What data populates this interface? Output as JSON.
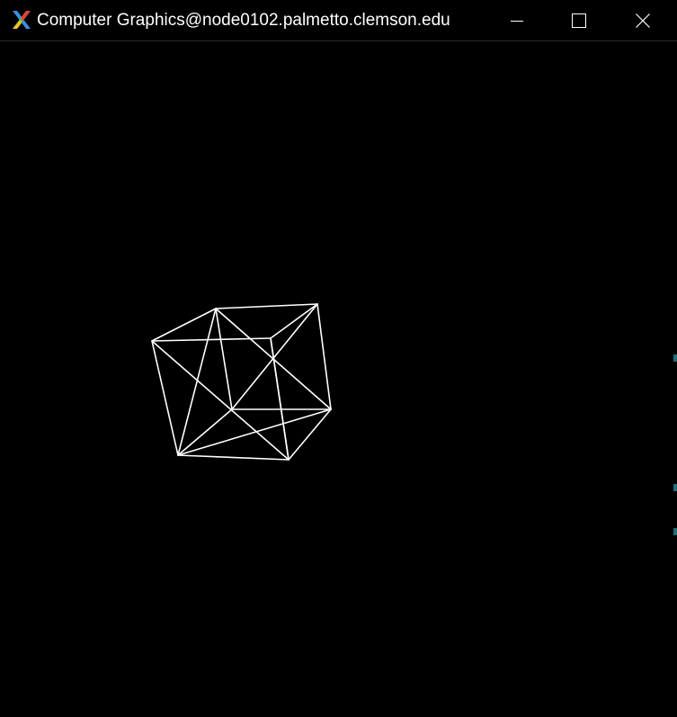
{
  "window": {
    "title": "Computer Graphics@node0102.palmetto.clemson.edu",
    "icon": "x-window-system-icon",
    "controls": {
      "minimize_icon": "minimize-icon",
      "maximize_icon": "maximize-icon",
      "close_icon": "close-icon"
    }
  },
  "scene": {
    "background": "#000000",
    "line_color": "#ffffff",
    "object": "wireframe-cube-with-diagonals"
  }
}
